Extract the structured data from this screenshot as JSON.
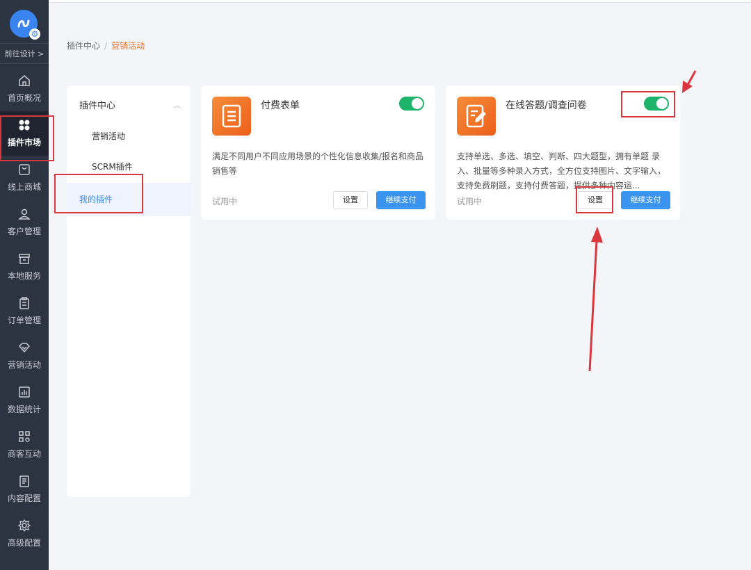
{
  "sidebar": {
    "logo_icon": "app-logo-gear-icon",
    "design_link": "前往设计 >",
    "items": [
      {
        "label": "首页概况",
        "icon": "home-icon"
      },
      {
        "label": "插件市场",
        "icon": "clover-icon",
        "active": true
      },
      {
        "label": "线上商城",
        "icon": "mall-icon"
      },
      {
        "label": "客户管理",
        "icon": "user-icon"
      },
      {
        "label": "本地服务",
        "icon": "store-icon"
      },
      {
        "label": "订单管理",
        "icon": "clipboard-icon"
      },
      {
        "label": "营销活动",
        "icon": "diamond-icon"
      },
      {
        "label": "数据统计",
        "icon": "chart-icon"
      },
      {
        "label": "商客互动",
        "icon": "scan-icon"
      },
      {
        "label": "内容配置",
        "icon": "document-icon"
      },
      {
        "label": "高级配置",
        "icon": "gear-icon"
      }
    ]
  },
  "breadcrumb": {
    "root": "插件中心",
    "separator": "/",
    "current": "营销活动"
  },
  "plugin_menu": {
    "group": "插件中心",
    "sub_items": [
      "营销活动",
      "SCRM插件"
    ],
    "mine": "我的插件"
  },
  "cards": [
    {
      "title": "付费表单",
      "icon": "form-document-icon",
      "enabled": true,
      "description": "满足不同用户不同应用场景的个性化信息收集/报名和商品销售等",
      "status": "试用中",
      "settings_label": "设置",
      "pay_label": "继续支付"
    },
    {
      "title": "在线答题/调查问卷",
      "icon": "edit-document-icon",
      "enabled": true,
      "description": "支持单选、多选、填空、判断、四大题型，拥有单题 录入、批量等多种录入方式，全方位支持图片、文字输入，支持免费刷题，支持付费答题，提供多种内容运...",
      "status": "试用中",
      "settings_label": "设置",
      "pay_label": "继续支付"
    }
  ],
  "colors": {
    "sidebar_bg": "#2c3341",
    "accent_orange": "#e8742c",
    "toggle_green": "#1db36b",
    "primary_blue": "#3a93ef",
    "annotation_red": "#d9363e"
  }
}
